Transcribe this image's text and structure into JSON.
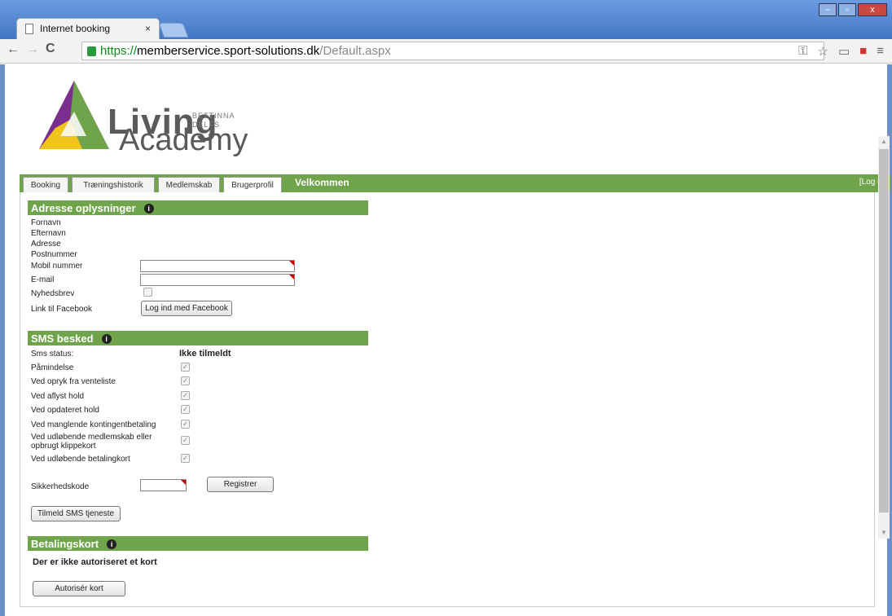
{
  "browser": {
    "tab_title": "Internet booking",
    "tab_close": "×",
    "url_scheme": "https://",
    "url_host": "memberservice.sport-solutions.dk",
    "url_path": "/Default.aspx",
    "win_min": "–",
    "win_max": "▫",
    "win_close": "x"
  },
  "logo": {
    "living": "Living",
    "academy": "Academy",
    "bettinna": "BETTINNA",
    "delfs": "DELFS"
  },
  "menu": {
    "tabs": [
      "Booking",
      "Træningshistorik",
      "Medlemskab",
      "Brugerprofil"
    ],
    "welcome": "Velkommen",
    "logout": "[Log ud]"
  },
  "address": {
    "title": "Adresse oplysninger",
    "labels": [
      "Fornavn",
      "Efternavn",
      "Adresse",
      "Postnummer",
      "Mobil nummer",
      "E-mail",
      "Nyhedsbrev",
      "Link til Facebook"
    ],
    "facebook_button": "Log ind med Facebook"
  },
  "sms": {
    "title": "SMS besked",
    "status_label": "Sms status:",
    "status_value": "Ikke tilmeldt",
    "options": [
      "Påmindelse",
      "Ved opryk fra venteliste",
      "Ved aflyst hold",
      "Ved opdateret hold",
      "Ved manglende kontingentbetaling",
      "Ved udløbende medlemskab eller opbrugt klippekort",
      "Ved udløbende betalingkort"
    ],
    "security_label": "Sikkerhedskode",
    "register_button": "Registrer",
    "subscribe_button": "Tilmeld SMS tjeneste"
  },
  "payment": {
    "title": "Betalingskort",
    "message": "Der er ikke autoriseret et kort",
    "authorize_button": "Autorisér kort"
  },
  "colors": {
    "accent_green": "#6fa44a",
    "chrome_blue": "#4377c4"
  }
}
